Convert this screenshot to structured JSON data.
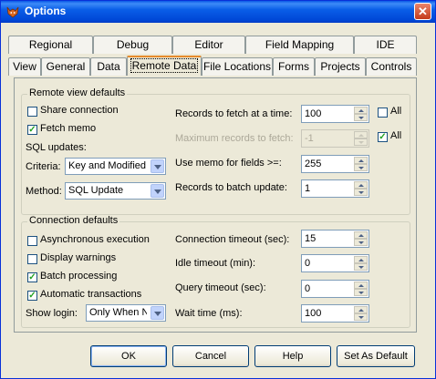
{
  "window": {
    "title": "Options",
    "close_glyph": "✕",
    "icon": "fox-app-icon"
  },
  "tabs_row1": [
    "Regional",
    "Debug",
    "Editor",
    "Field Mapping",
    "IDE"
  ],
  "tabs_row2": [
    "View",
    "General",
    "Data",
    "Remote Data",
    "File Locations",
    "Forms",
    "Projects",
    "Controls"
  ],
  "active_tab": "Remote Data",
  "remote_view": {
    "group_label": "Remote view defaults",
    "share_connection": {
      "label": "Share connection",
      "checked": false
    },
    "fetch_memo": {
      "label": "Fetch memo",
      "checked": true
    },
    "sql_updates_label": "SQL updates:",
    "criteria": {
      "label": "Criteria:",
      "value": "Key and Modified Fields"
    },
    "method": {
      "label": "Method:",
      "value": "SQL Update"
    },
    "records_to_fetch": {
      "label": "Records to fetch at a time:",
      "value": "100",
      "all_label": "All",
      "all_checked": false
    },
    "max_records": {
      "label": "Maximum records to fetch:",
      "value": "-1",
      "all_label": "All",
      "all_checked": true
    },
    "use_memo": {
      "label": "Use memo for fields >=:",
      "value": "255"
    },
    "batch_update": {
      "label": "Records to batch update:",
      "value": "1"
    }
  },
  "connection": {
    "group_label": "Connection defaults",
    "async": {
      "label": "Asynchronous execution",
      "checked": false
    },
    "display_warnings": {
      "label": "Display warnings",
      "checked": false
    },
    "batch_processing": {
      "label": "Batch processing",
      "checked": true
    },
    "auto_transactions": {
      "label": "Automatic transactions",
      "checked": true
    },
    "show_login": {
      "label": "Show login:",
      "value": "Only When Needed"
    },
    "connection_timeout": {
      "label": "Connection timeout (sec):",
      "value": "15"
    },
    "idle_timeout": {
      "label": "Idle timeout (min):",
      "value": "0"
    },
    "query_timeout": {
      "label": "Query timeout (sec):",
      "value": "0"
    },
    "wait_time": {
      "label": "Wait time (ms):",
      "value": "100"
    }
  },
  "buttons": {
    "ok": "OK",
    "cancel": "Cancel",
    "help": "Help",
    "set_default": "Set As Default"
  },
  "colors": {
    "title_bar": "#0a58e6",
    "dialog_bg": "#ece9d8",
    "active_tab_accent": "#e68b2c",
    "check_mark": "#21a121"
  }
}
